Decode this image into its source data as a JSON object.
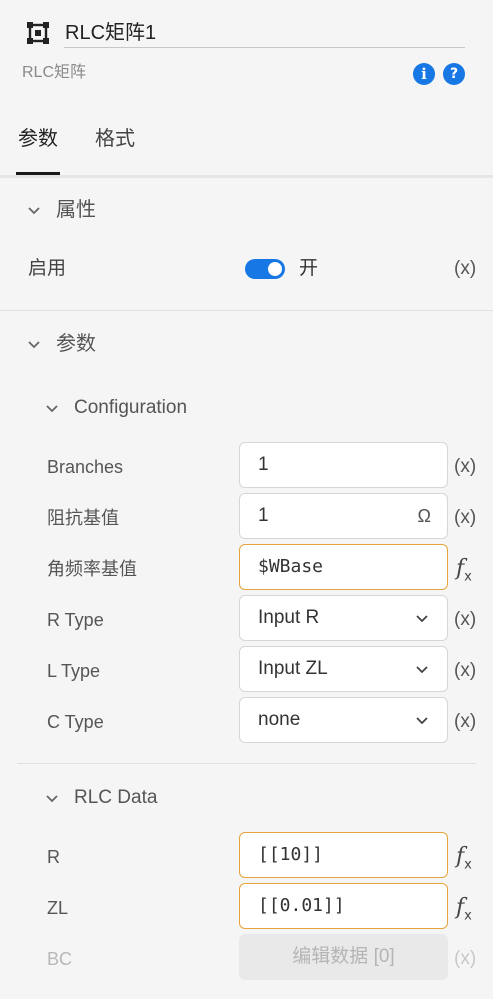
{
  "header": {
    "component_name": "RLC矩阵1",
    "component_type": "RLC矩阵",
    "info_icon": "info-icon",
    "help_icon": "help-icon"
  },
  "tabs": [
    {
      "label": "参数",
      "active": true
    },
    {
      "label": "格式",
      "active": false
    }
  ],
  "sections": {
    "properties": {
      "title": "属性",
      "enable": {
        "label": "启用",
        "state_label": "开",
        "on": true,
        "var_label": "(x)"
      }
    },
    "params": {
      "title": "参数",
      "configuration": {
        "title": "Configuration",
        "rows": [
          {
            "label": "Branches",
            "value": "1",
            "unit": "",
            "kind": "input",
            "action": "(x)"
          },
          {
            "label": "阻抗基值",
            "value": "1",
            "unit": "Ω",
            "kind": "input",
            "action": "(x)"
          },
          {
            "label": "角频率基值",
            "value": "$WBase",
            "unit": "",
            "kind": "expr",
            "action": "fx"
          },
          {
            "label": "R Type",
            "value": "Input R",
            "unit": "",
            "kind": "select",
            "action": "(x)"
          },
          {
            "label": "L Type",
            "value": "Input ZL",
            "unit": "",
            "kind": "select",
            "action": "(x)"
          },
          {
            "label": "C Type",
            "value": "none",
            "unit": "",
            "kind": "select",
            "action": "(x)"
          }
        ]
      },
      "rlc_data": {
        "title": "RLC Data",
        "rows": [
          {
            "label": "R",
            "value": "[[10]]",
            "kind": "expr",
            "action": "fx"
          },
          {
            "label": "ZL",
            "value": "[[0.01]]",
            "kind": "expr",
            "action": "fx"
          },
          {
            "label": "BC",
            "value": "编辑数据 [0]",
            "kind": "disabled-button",
            "action": "(x)"
          }
        ]
      }
    }
  },
  "fx_symbol": "f",
  "fx_sub": "x",
  "colors": {
    "accent": "#1677e5",
    "expr_border": "#e8a23c",
    "background": "#f5f5f5"
  }
}
